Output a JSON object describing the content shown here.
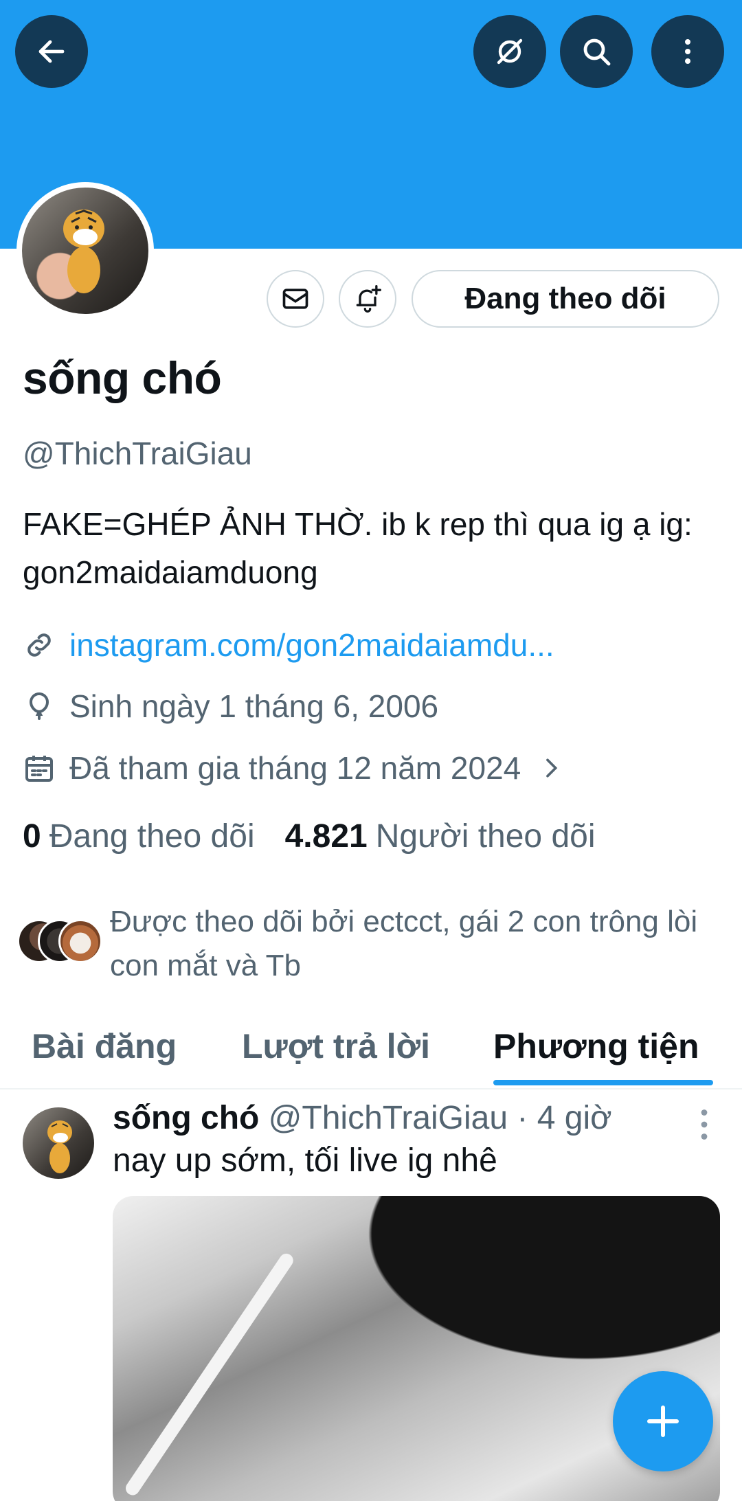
{
  "profile": {
    "name": "sống chó",
    "handle": "@ThichTraiGiau",
    "bio": "FAKE=GHÉP ẢNH THỜ. ib k rep thì qua ig ạ ig: gon2maidaiamduong",
    "link": "instagram.com/gon2maidaiamdu...",
    "birthday": "Sinh ngày 1 tháng 6, 2006",
    "joined": "Đã tham gia tháng 12 năm 2024",
    "following_count": "0",
    "following_label": "Đang theo dõi",
    "followers_count": "4.821",
    "followers_label": "Người theo dõi",
    "followed_by": "Được theo dõi bởi ectcct, gái 2 con trông lòi con mắt và Tb",
    "follow_button": "Đang theo dõi"
  },
  "tabs": [
    {
      "label": "Bài đăng",
      "active": false
    },
    {
      "label": "Lượt trả lời",
      "active": false
    },
    {
      "label": "Phương tiện",
      "active": true
    }
  ],
  "post": {
    "author": "sống chó",
    "handle": "@ThichTraiGiau",
    "time": "· 4 giờ",
    "text": "nay up sớm, tối live ig nhê"
  },
  "icons": {
    "back": "arrow-left-icon",
    "grok": "grok-icon",
    "search": "search-icon",
    "more": "more-vertical-icon",
    "message": "envelope-icon",
    "notify": "bell-plus-icon",
    "link": "link-icon",
    "birthday": "balloon-icon",
    "joined": "calendar-icon",
    "chevron": "chevron-right-icon",
    "compose": "plus-icon"
  },
  "colors": {
    "accent": "#1d9bf0",
    "text": "#0f1419",
    "secondary": "#536471"
  }
}
